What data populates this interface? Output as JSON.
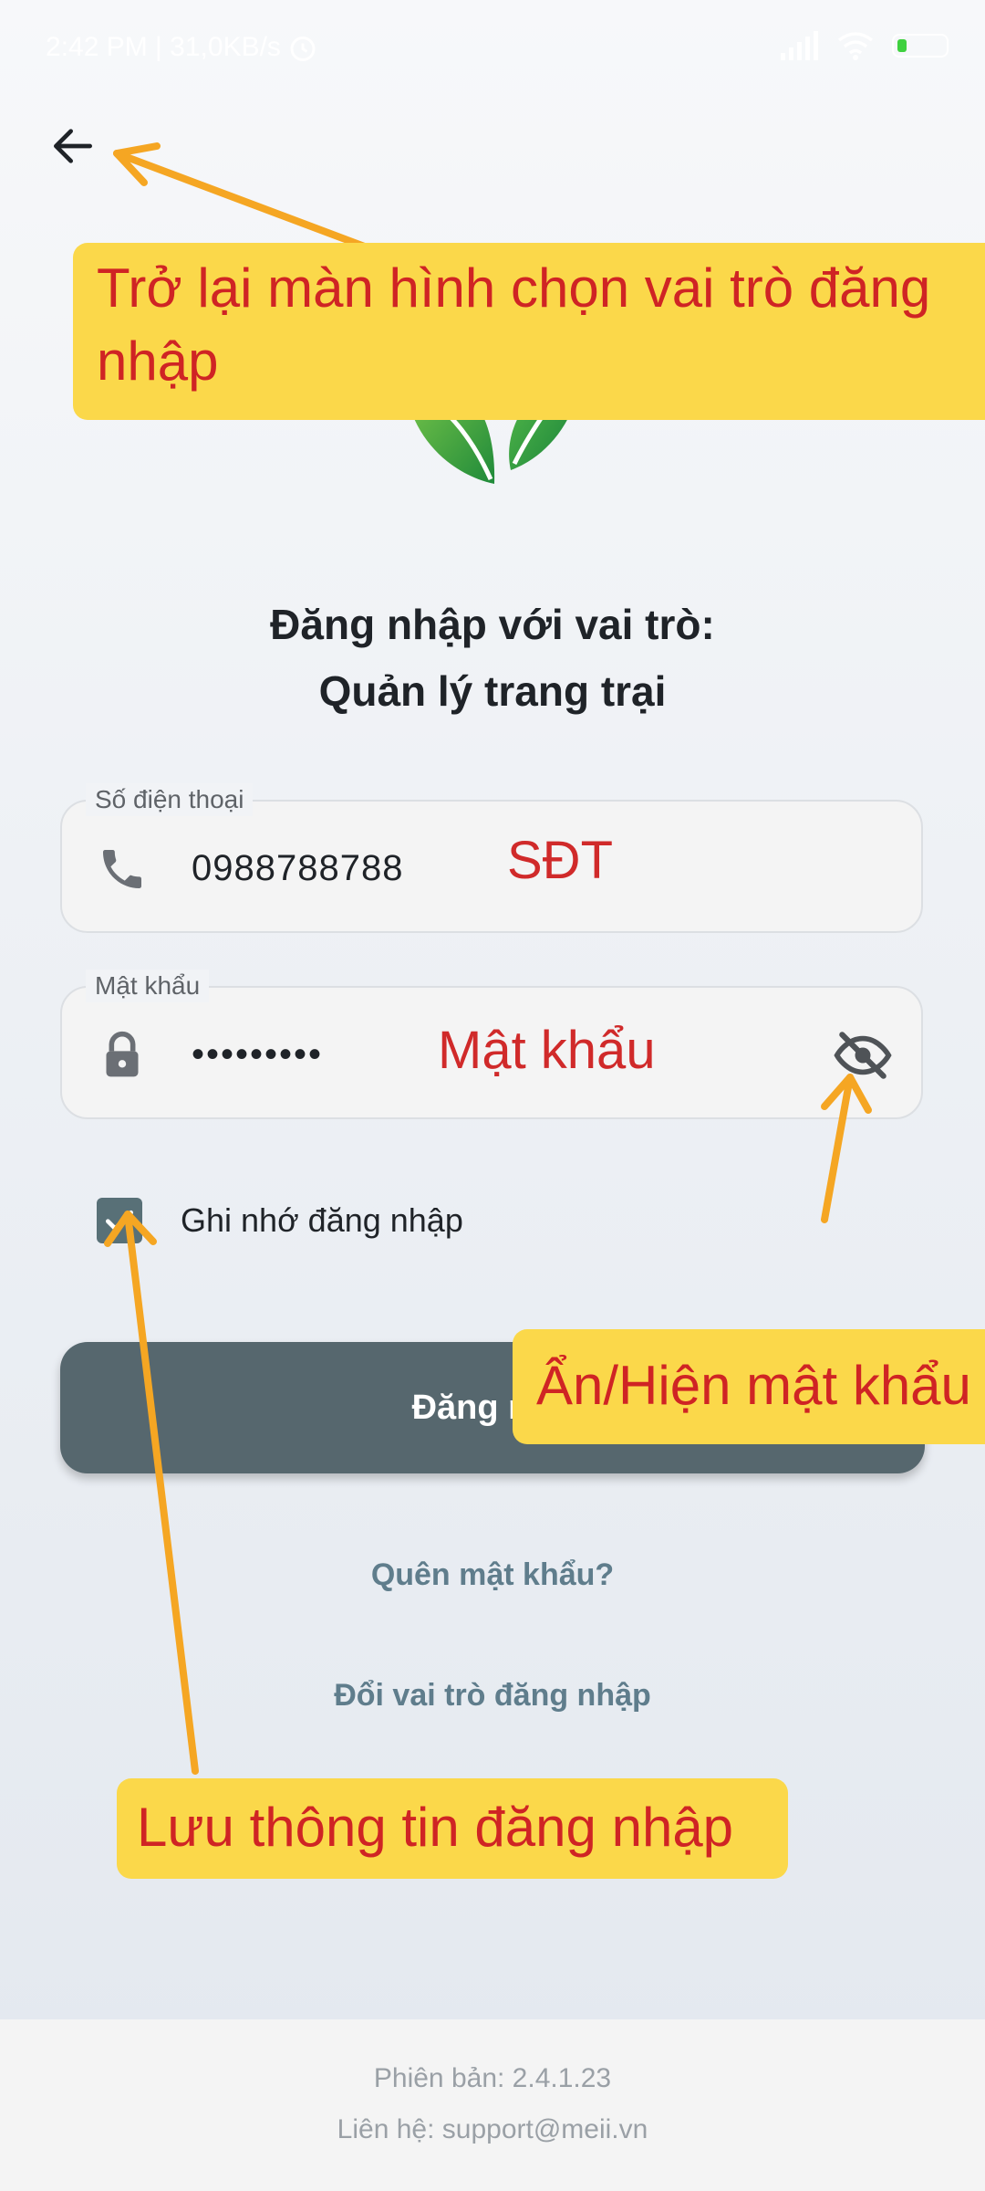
{
  "status_bar": {
    "time_speed": "2:42 PM | 31,0KB/s"
  },
  "header": {
    "back_icon": "arrow-left-icon"
  },
  "logo": {
    "icon": "green-leaves-logo"
  },
  "title": {
    "line1": "Đăng nhập với vai trò:",
    "line2": "Quản lý trang trại"
  },
  "phone_field": {
    "label": "Số điện thoại",
    "value": "0988788788",
    "icon": "phone-icon",
    "hint": "SĐT"
  },
  "password_field": {
    "label": "Mật khẩu",
    "value": "•••••••••",
    "icon": "lock-icon",
    "toggle_icon": "eye-off-icon",
    "hint": "Mật khẩu"
  },
  "remember": {
    "checked": true,
    "label": "Ghi nhớ đăng nhập"
  },
  "login_button": {
    "label": "Đăng n"
  },
  "links": {
    "forgot_password": "Quên mật khẩu?",
    "change_role": "Đổi vai trò đăng nhập"
  },
  "footer": {
    "version": "Phiên bản: 2.4.1.23",
    "contact": "Liên hệ: support@meii.vn"
  },
  "annotations": {
    "back": "Trở lại màn hình chọn vai trò đăng nhập",
    "toggle": "Ẩn/Hiện mật khẩu",
    "remember": "Lưu thông tin đăng nhập"
  },
  "colors": {
    "button": "#56676e",
    "link": "#5f7d8c",
    "callout_bg": "#fbd84a",
    "callout_text": "#cf2424",
    "arrow": "#f5a623"
  }
}
